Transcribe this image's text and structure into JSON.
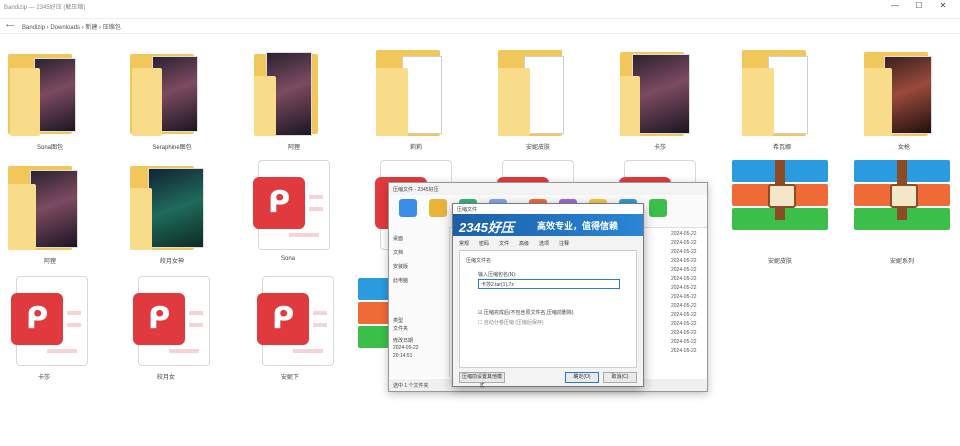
{
  "window": {
    "title": "Bandizip — 2345好压 (解压缩)",
    "minimize": "—",
    "maximize": "☐",
    "close": "✕"
  },
  "address": {
    "back": "⟵",
    "forward": "⟶",
    "path": "Bandizip › Downloads › 新建 › 压缩包"
  },
  "row1": [
    {
      "label": "Sona图包"
    },
    {
      "label": "Seraphine图包"
    },
    {
      "label": "阿狸"
    },
    {
      "label": "莉莉"
    },
    {
      "label": "安妮皮肤"
    },
    {
      "label": "卡莎"
    },
    {
      "label": "希瓦娜"
    },
    {
      "label": "女枪"
    }
  ],
  "row2": [
    {
      "label": "阿狸"
    },
    {
      "label": "皎月女神"
    },
    {
      "label": "Sona"
    },
    {
      "label": "莉莉"
    },
    {
      "label": "卡莎"
    },
    {
      "label": "安妮"
    },
    {
      "label": "安妮皮肤"
    },
    {
      "label": "安妮系列"
    }
  ],
  "row3": [
    {
      "label": "卡莎"
    },
    {
      "label": "皎月女"
    },
    {
      "label": "安妮下"
    }
  ],
  "icons": {
    "pdf_glyph": "ᑭ"
  },
  "backwin": {
    "title": "压缩文件 - 2345好压",
    "status": "选中 1 个文件夹",
    "nav": [
      "桌面",
      "文档",
      "安装版",
      "此电脑"
    ],
    "dates": [
      "2024-05-22",
      "2024-05-22",
      "2024-05-22",
      "2024-05-22",
      "2024-05-22",
      "2024-05-22",
      "2024-05-22",
      "2024-05-22",
      "2024-05-22",
      "2024-05-22",
      "2024-05-22",
      "2024-05-22",
      "2024-05-22",
      "2024-05-22"
    ],
    "info": [
      "类型",
      "文件夹",
      "修改日期",
      "2024-05-22",
      "20:14:51"
    ]
  },
  "dialog": {
    "title": "压缩文件",
    "logo": "2345好压",
    "slogan": "高效专业，值得信赖",
    "tabs": [
      "常规",
      "密码",
      "文件",
      "高级",
      "选项",
      "注释"
    ],
    "section": "压缩文件名",
    "input_label": "输入压缩包名(N):",
    "input_value": "卡莎2.tar(1).7z",
    "option1": "☑ 压缩完成后(不包含原文件名,压缩前删除)",
    "option2": "☐ 自动分卷压缩 (压缩后保存)",
    "btn_other": "压缩前设置其他模式",
    "ok": "确定(O)",
    "cancel": "取消(C)"
  }
}
